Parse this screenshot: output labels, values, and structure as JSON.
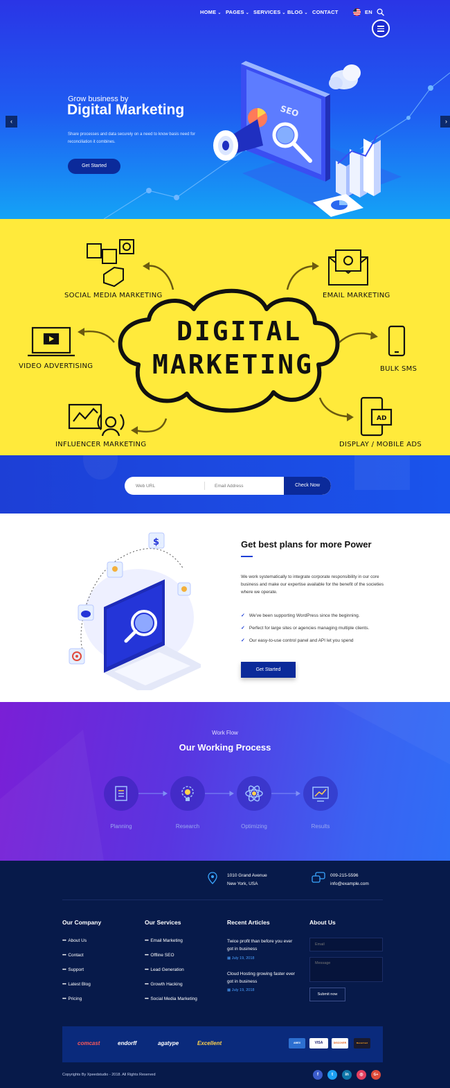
{
  "nav": {
    "items": [
      {
        "label": "HOME",
        "has_dropdown": true
      },
      {
        "label": "PAGES",
        "has_dropdown": true
      },
      {
        "label": "SERVICES",
        "has_dropdown": true
      },
      {
        "label": "BLOG",
        "has_dropdown": true
      },
      {
        "label": "CONTACT",
        "has_dropdown": false
      }
    ],
    "language": "EN",
    "icons": [
      "us-flag-icon",
      "search-icon",
      "hamburger-menu-icon"
    ]
  },
  "hero": {
    "subtitle": "Grow business by",
    "title": "Digital Marketing",
    "description": "Share processes and data securely on a need to know basis need for reconciliation it combines.",
    "cta": "Get Started",
    "illustration_text": "SEO",
    "prev_arrow": "‹",
    "next_arrow": "›"
  },
  "infographic": {
    "center_line1": "DIGITAL",
    "center_line2": "MARKETING",
    "labels": {
      "social": "SOCIAL MEDIA MARKETING",
      "email": "EMAIL MARKETING",
      "video": "VIDEO ADVERTISING",
      "sms": "BULK SMS",
      "influencer": "INFLUENCER MARKETING",
      "display": "DISPLAY / MOBILE ADS"
    },
    "ad_text": "AD"
  },
  "check_form": {
    "url_placeholder": "Web URL",
    "email_placeholder": "Email Address",
    "button": "Check Now"
  },
  "plans": {
    "title": "Get best plans for more Power",
    "description": "We work systematically to integrate corporate responsibility in our core business and make our expertise available for the benefit of the societies where we operate.",
    "features": [
      "We've been supporting WordPress since the beginning.",
      "Perfect for large sites or agencies managing multiple clients.",
      "Our easy-to-use control panel and API let you spend"
    ],
    "cta": "Get Started"
  },
  "process": {
    "subtitle": "Work Flow",
    "title": "Our Working Process",
    "steps": [
      {
        "label": "Planning",
        "icon": "checklist-icon"
      },
      {
        "label": "Research",
        "icon": "lightbulb-gear-icon"
      },
      {
        "label": "Optimizing",
        "icon": "atom-icon"
      },
      {
        "label": "Results",
        "icon": "chart-icon"
      }
    ]
  },
  "footer": {
    "address_line1": "1010 Grand Avenue",
    "address_line2": "New York, USA",
    "phone": "009-215-5596",
    "email": "info@example.com",
    "company": {
      "title": "Our Company",
      "links": [
        "About Us",
        "Contact",
        "Support",
        "Latest Blog",
        "Pricing"
      ]
    },
    "services": {
      "title": "Our Services",
      "links": [
        "Email Marketing",
        "Offline SEO",
        "Lead Generation",
        "Growth Hacking",
        "Social Media Marketing"
      ]
    },
    "articles": {
      "title": "Recent Articles",
      "items": [
        {
          "title": "Twice profit than before you ever got in business",
          "date": "July 19, 2018"
        },
        {
          "title": "Cloud Hosting growing faster ever got in business",
          "date": "July 19, 2018"
        }
      ]
    },
    "about": {
      "title": "About Us",
      "email_placeholder": "Email",
      "message_placeholder": "Message",
      "submit": "Submit now"
    },
    "brands": [
      "comcast",
      "endorff",
      "agatype",
      "Excellent"
    ],
    "payments": [
      "AMEX",
      "VISA",
      "DISCOVER",
      "MasterCard"
    ],
    "copyright": "Copyrights By Xpeedstudio - 2018. All Rights Reserved",
    "social": [
      {
        "icon": "facebook-icon",
        "glyph": "f",
        "color": "#3b5ccc"
      },
      {
        "icon": "twitter-icon",
        "glyph": "t",
        "color": "#1da1f2"
      },
      {
        "icon": "linkedin-icon",
        "glyph": "in",
        "color": "#0e76a8"
      },
      {
        "icon": "instagram-icon",
        "glyph": "◎",
        "color": "#e4405f"
      },
      {
        "icon": "google-plus-icon",
        "glyph": "G+",
        "color": "#dd4b39"
      }
    ]
  },
  "colors": {
    "hero_top": "#2a35e6",
    "hero_bottom": "#14a3f6",
    "info_yellow": "#ffea3b",
    "button_dark_blue": "#0b2a9a",
    "footer_bg": "#071a4a",
    "process_purple": "#7a1fd6",
    "process_blue": "#2f6ef6"
  }
}
